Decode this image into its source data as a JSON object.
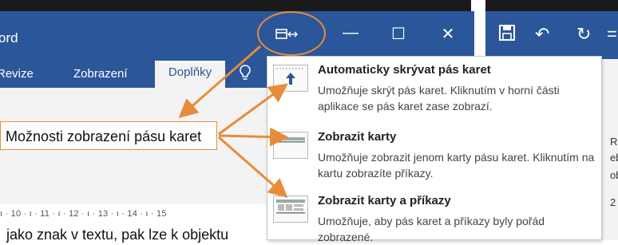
{
  "window": {
    "title": "ord",
    "tabs": [
      "Revize",
      "Zobrazení",
      "Doplňky"
    ],
    "controls": {
      "ribbon_options_icon": "ribbon-display-options-icon",
      "minimize": "—",
      "maximize": "☐",
      "close": "✕"
    }
  },
  "right_window": {
    "save_icon": "🖫",
    "undo": "↶",
    "redo": "↻",
    "more": "=",
    "side_text": [
      "R",
      "eb",
      "ob",
      "2"
    ]
  },
  "document": {
    "ruler": "ı · 10 · ı · 11 · ı · 12 · ı · 13 · ı · 14 · ı · 15",
    "text": "jako znak v textu, pak lze k objektu"
  },
  "callout": {
    "text": "Možnosti zobrazení pásu karet"
  },
  "menu": {
    "items": [
      {
        "title": "Automaticky skrývat pás karet",
        "description": "Umožňuje skrýt pás karet. Kliknutím v horní části aplikace se pás karet zase zobrazí."
      },
      {
        "title": "Zobrazit karty",
        "description": "Umožňuje zobrazit jenom karty pásu karet. Kliknutím na kartu zobrazíte příkazy."
      },
      {
        "title": "Zobrazit karty a příkazy",
        "description": "Umožňuje, aby pás karet a příkazy byly pořád zobrazené."
      }
    ]
  },
  "colors": {
    "word_blue": "#2b579a",
    "annotation_orange": "#e88b3a",
    "ribbon_gray": "#f3f3f3"
  }
}
